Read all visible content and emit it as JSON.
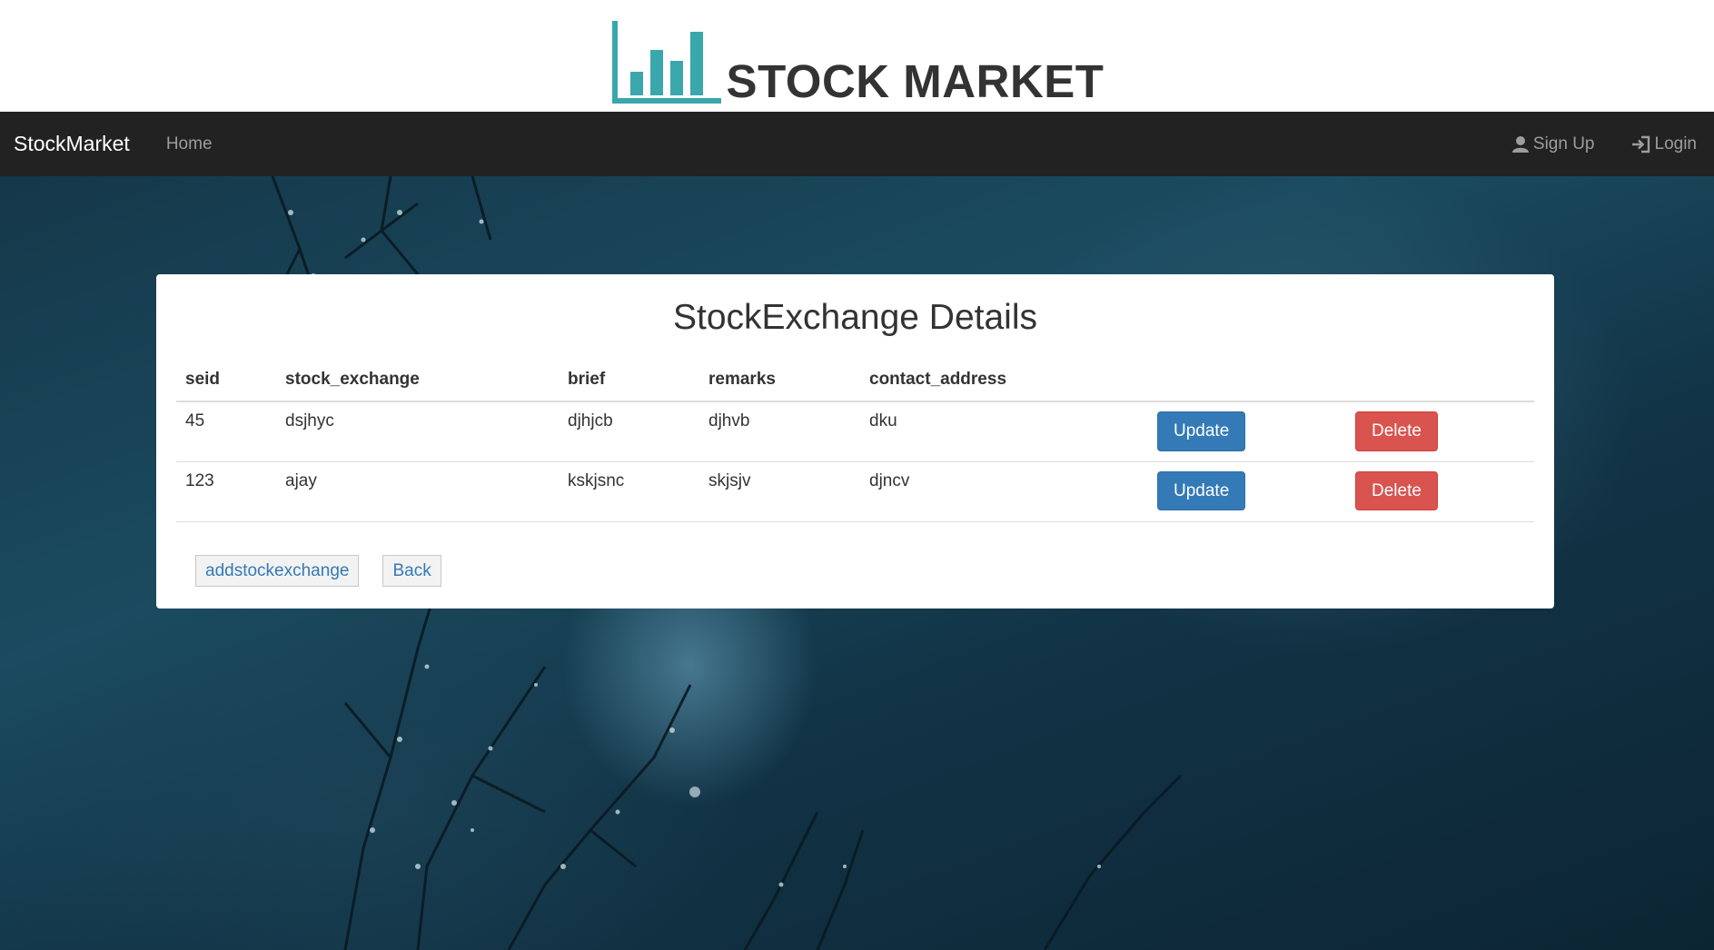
{
  "header": {
    "logo_text": "STOCK MARKET",
    "logo_color": "#3aa7ac"
  },
  "navbar": {
    "brand": "StockMarket",
    "home": "Home",
    "signup": "Sign Up",
    "login": "Login"
  },
  "panel": {
    "title": "StockExchange Details",
    "columns": [
      "seid",
      "stock_exchange",
      "brief",
      "remarks",
      "contact_address"
    ],
    "rows": [
      {
        "seid": "45",
        "stock_exchange": "dsjhyc",
        "brief": "djhjcb",
        "remarks": "djhvb",
        "contact_address": "dku"
      },
      {
        "seid": "123",
        "stock_exchange": "ajay",
        "brief": "kskjsnc",
        "remarks": "skjsjv",
        "contact_address": "djncv"
      }
    ],
    "update_label": "Update",
    "delete_label": "Delete",
    "add_label": "addstockexchange",
    "back_label": "Back"
  },
  "colors": {
    "navbar": "#222222",
    "primary": "#337ab7",
    "danger": "#d9534f"
  }
}
